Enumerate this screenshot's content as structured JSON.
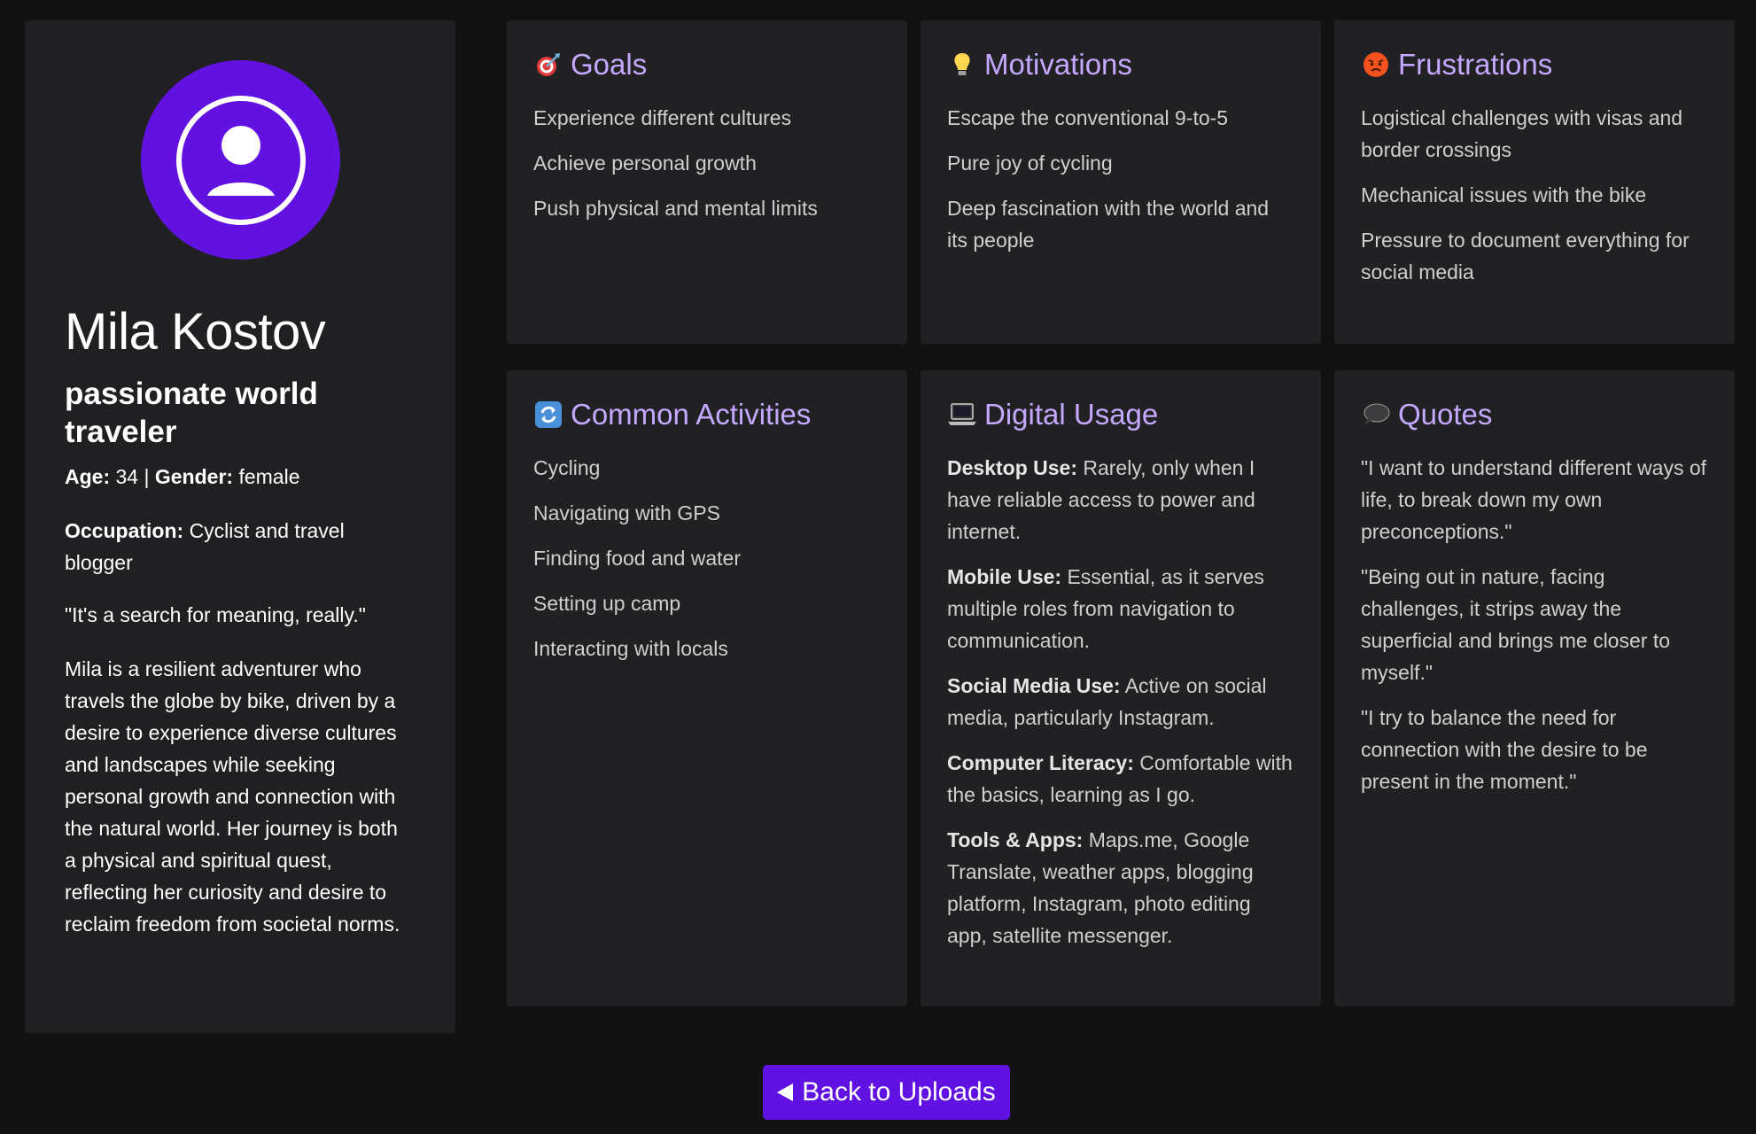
{
  "profile": {
    "name": "Mila Kostov",
    "tagline": "passionate world traveler",
    "age_label": "Age:",
    "age": "34",
    "separator": "|",
    "gender_label": "Gender:",
    "gender": "female",
    "occupation_label": "Occupation:",
    "occupation": "Cyclist and travel blogger",
    "quote": "\"It's a search for meaning, really.\"",
    "bio": "Mila is a resilient adventurer who travels the globe by bike, driven by a desire to experience diverse cultures and landscapes while seeking personal growth and connection with the natural world. Her journey is both a physical and spiritual quest, reflecting her curiosity and desire to reclaim freedom from societal norms."
  },
  "goals": {
    "icon": "target-icon",
    "title": "Goals",
    "items": [
      "Experience different cultures",
      "Achieve personal growth",
      "Push physical and mental limits"
    ]
  },
  "motivations": {
    "icon": "lightbulb-icon",
    "title": "Motivations",
    "items": [
      "Escape the conventional 9-to-5",
      "Pure joy of cycling",
      "Deep fascination with the world and its people"
    ]
  },
  "frustrations": {
    "icon": "angry-face-icon",
    "title": "Frustrations",
    "items": [
      "Logistical challenges with visas and border crossings",
      "Mechanical issues with the bike",
      "Pressure to document everything for social media"
    ]
  },
  "activities": {
    "icon": "refresh-icon",
    "title": "Common Activities",
    "items": [
      "Cycling",
      "Navigating with GPS",
      "Finding food and water",
      "Setting up camp",
      "Interacting with locals"
    ]
  },
  "digital": {
    "icon": "laptop-icon",
    "title": "Digital Usage",
    "items": [
      {
        "label": "Desktop Use:",
        "text": "Rarely, only when I have reliable access to power and internet."
      },
      {
        "label": "Mobile Use:",
        "text": "Essential, as it serves multiple roles from navigation to communication."
      },
      {
        "label": "Social Media Use:",
        "text": "Active on social media, particularly Instagram."
      },
      {
        "label": "Computer Literacy:",
        "text": "Comfortable with the basics, learning as I go."
      },
      {
        "label": "Tools & Apps:",
        "text": "Maps.me, Google Translate, weather apps, blogging platform, Instagram, photo editing app, satellite messenger."
      }
    ]
  },
  "quotes": {
    "icon": "speech-bubble-icon",
    "title": "Quotes",
    "items": [
      "\"I want to understand different ways of life, to break down my own preconceptions.\"",
      "\"Being out in nature, facing challenges, it strips away the superficial and brings me closer to myself.\"",
      "\"I try to balance the need for connection with the desire to be present in the moment.\""
    ]
  },
  "back_button": {
    "label": "Back to Uploads",
    "icon": "back-triangle-icon"
  },
  "colors": {
    "accent": "#6212e0",
    "heading": "#c5a8ff",
    "card": "#212123",
    "background": "#121213"
  }
}
